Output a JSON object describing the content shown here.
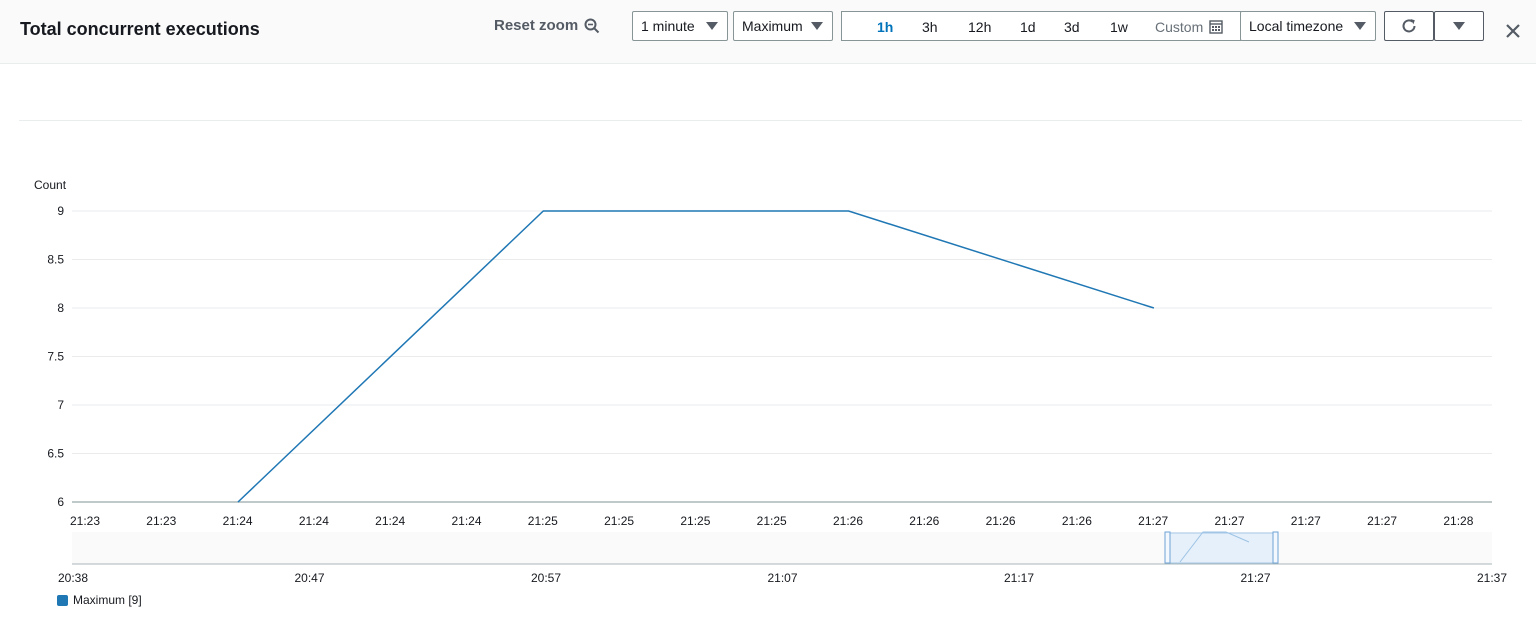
{
  "header": {
    "title": "Total concurrent executions",
    "reset_zoom": "Reset zoom",
    "period": "1 minute",
    "statistic": "Maximum",
    "ranges": [
      "1h",
      "3h",
      "12h",
      "1d",
      "3d",
      "1w"
    ],
    "active_range": "1h",
    "custom": "Custom",
    "timezone": "Local timezone"
  },
  "icons": {
    "zoom": "zoom-out-icon",
    "calendar": "calendar-icon",
    "refresh": "refresh-icon",
    "dropdown": "chevron-down-icon",
    "close": "close-icon"
  },
  "colors": {
    "series": "#1f77b4",
    "accent": "#0073bb"
  },
  "chart_data": {
    "type": "line",
    "ylabel": "Count",
    "ylim": [
      6,
      9
    ],
    "yticks": [
      "9",
      "8.5",
      "8",
      "7.5",
      "7",
      "6.5",
      "6"
    ],
    "xticks": [
      "21:23",
      "21:23",
      "21:24",
      "21:24",
      "21:24",
      "21:24",
      "21:25",
      "21:25",
      "21:25",
      "21:25",
      "21:26",
      "21:26",
      "21:26",
      "21:26",
      "21:27",
      "21:27",
      "21:27",
      "21:27",
      "21:28"
    ],
    "x": [
      "21:24",
      "21:25",
      "21:26",
      "21:27"
    ],
    "series": [
      {
        "name": "Maximum",
        "values": [
          6,
          9,
          9,
          8
        ]
      }
    ],
    "navigator_ticks": [
      "20:38",
      "20:47",
      "20:57",
      "21:07",
      "21:17",
      "21:27",
      "21:37"
    ],
    "legend": "Maximum [9]",
    "grid": true
  }
}
